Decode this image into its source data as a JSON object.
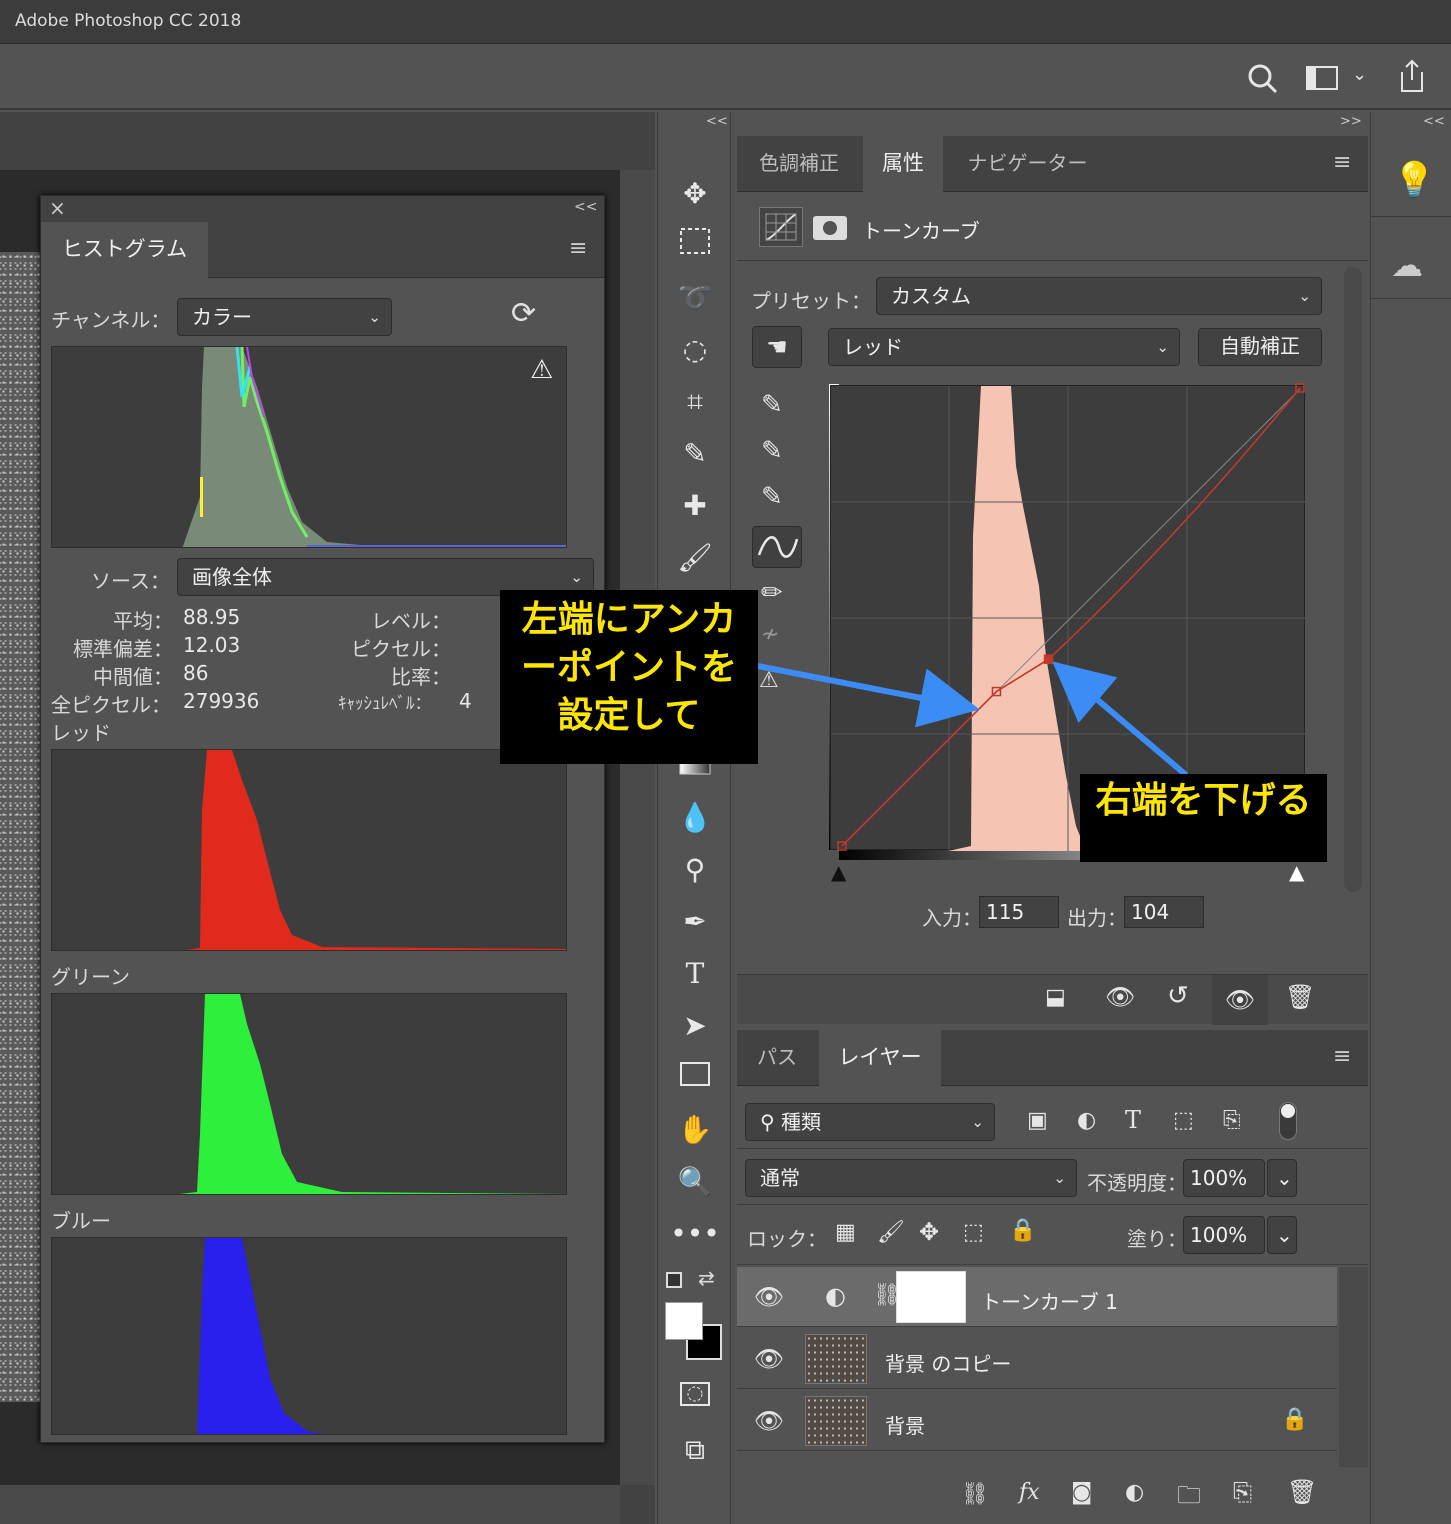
{
  "app": {
    "title": "Adobe Photoshop CC 2018"
  },
  "icons": {
    "search": "search-icon",
    "workspace": "workspace-icon",
    "share": "share-icon",
    "collapse": "<<",
    "expand": ">>",
    "menu": "≡",
    "close": "×",
    "refresh": "⟳",
    "warning": "⚠"
  },
  "histogram": {
    "tab": "ヒストグラム",
    "channel_label": "チャンネル：",
    "channel_value": "カラー",
    "source_label": "ソース：",
    "source_value": "画像全体",
    "stats": {
      "mean_label": "平均：",
      "mean": "88.95",
      "std_label": "標準偏差：",
      "std": "12.03",
      "median_label": "中間値：",
      "median": "86",
      "pixels_label": "全ピクセル：",
      "pixels": "279936",
      "level_label": "レベル：",
      "count_label": "ピクセル：",
      "percentile_label": "比率：",
      "cache_label": "ｷｬｯｼｭﾚﾍﾞﾙ：",
      "cache": "4"
    },
    "channels": [
      {
        "name": "レッド",
        "color": "#e02a1c"
      },
      {
        "name": "グリーン",
        "color": "#2cf03a"
      },
      {
        "name": "ブルー",
        "color": "#2a20ee"
      }
    ]
  },
  "properties": {
    "tabs": [
      "色調補正",
      "属性",
      "ナビゲーター"
    ],
    "active_tab": 1,
    "adjustment_name": "トーンカーブ",
    "preset_label": "プリセット：",
    "preset_value": "カスタム",
    "channel_value": "レッド",
    "auto_button": "自動補正",
    "input_label": "入力：",
    "input_value": "115",
    "output_label": "出力：",
    "output_value": "104",
    "curve_points": [
      {
        "in": 0,
        "out": 0
      },
      {
        "in": 86,
        "out": 86
      },
      {
        "in": 115,
        "out": 104
      },
      {
        "in": 255,
        "out": 255
      }
    ]
  },
  "layers": {
    "tabs": [
      "パス",
      "レイヤー"
    ],
    "active_tab": 1,
    "filter_label": "種類",
    "blend_mode": "通常",
    "opacity_label": "不透明度：",
    "opacity": "100%",
    "lock_label": "ロック：",
    "fill_label": "塗り：",
    "fill": "100%",
    "items": [
      {
        "name": "トーンカーブ 1",
        "type": "adjustment",
        "selected": true
      },
      {
        "name": "背景 のコピー",
        "type": "pixel"
      },
      {
        "name": "背景",
        "type": "pixel",
        "locked": true
      }
    ]
  },
  "annotations": {
    "left_anchor": "左端にアンカーポイントを設定して",
    "right_down": "右端を下げる"
  },
  "colors": {
    "callout_bg": "#000000",
    "callout_text": "#ffe600",
    "arrow": "#3b8df5",
    "curve_line": "#c0392b",
    "hist_fill": "#f6c4b3"
  }
}
